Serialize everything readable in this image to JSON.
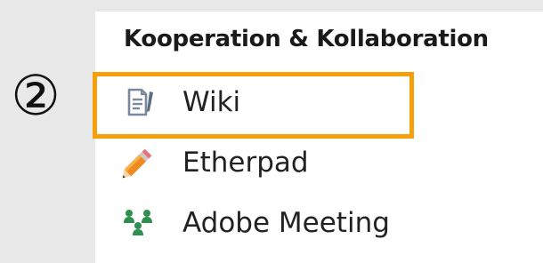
{
  "step_marker": "②",
  "section": {
    "title": "Kooperation & Kollaboration"
  },
  "menu": {
    "items": [
      {
        "label": "Wiki",
        "icon": "wiki-icon",
        "highlighted": true
      },
      {
        "label": "Etherpad",
        "icon": "pencil-icon",
        "highlighted": false
      },
      {
        "label": "Adobe Meeting",
        "icon": "meeting-people-icon",
        "highlighted": false
      }
    ]
  },
  "colors": {
    "background": "#e8e8e8",
    "panel": "#ffffff",
    "highlight": "#f5a00a",
    "icon_gray": "#7a8a9a",
    "pencil_orange": "#f08a1c",
    "meeting_green": "#2f8f4e"
  }
}
